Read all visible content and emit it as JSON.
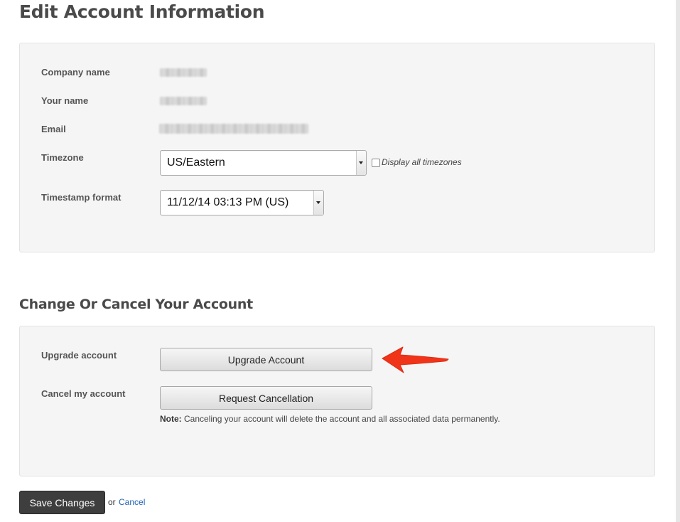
{
  "page_title": "Edit Account Information",
  "account_info": {
    "fields": [
      {
        "label": "Company name"
      },
      {
        "label": "Your name"
      },
      {
        "label": "Email"
      }
    ],
    "timezone": {
      "label": "Timezone",
      "value": "US/Eastern",
      "display_all_label": "Display all timezones",
      "display_all_checked": false
    },
    "timestamp_format": {
      "label": "Timestamp format",
      "value": "11/12/14 03:13 PM (US)"
    }
  },
  "change_section": {
    "title": "Change Or Cancel Your Account",
    "upgrade": {
      "label": "Upgrade account",
      "button": "Upgrade Account"
    },
    "cancel": {
      "label": "Cancel my account",
      "button": "Request Cancellation"
    },
    "note_bold": "Note:",
    "note_text": " Canceling your account will delete the account and all associated data permanently."
  },
  "footer": {
    "save_label": "Save Changes",
    "or_text": "or",
    "cancel_label": "Cancel"
  },
  "colors": {
    "annotation_arrow": "#f0341a",
    "link": "#1f62b5",
    "save_button": "#3e3e3e"
  },
  "icons": {
    "select_caret": "chevron-down-icon",
    "annotation": "arrow-left-icon"
  }
}
